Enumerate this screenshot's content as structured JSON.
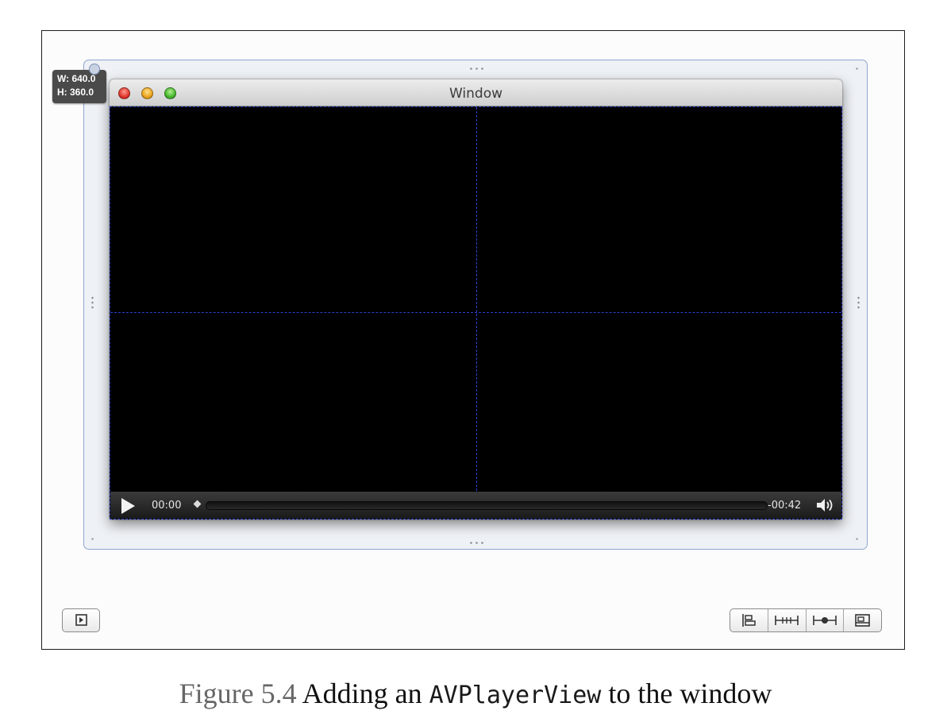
{
  "size_readout": {
    "width_label": "W: 640.0",
    "height_label": "H: 360.0"
  },
  "window": {
    "title": "Window"
  },
  "player": {
    "time_elapsed": "00:00",
    "time_remaining": "-00:42",
    "icons": {
      "play": "play-icon",
      "scrubber": "scrubber-knob-icon",
      "volume": "volume-icon"
    }
  },
  "canvas_buttons": {
    "left": "document-outline-icon",
    "right": [
      "align-icon",
      "pin-icon",
      "resolve-icon",
      "resizing-icon"
    ]
  },
  "caption": {
    "figure_number": "Figure 5.4",
    "text_before": "Adding an",
    "code": "AVPlayerView",
    "text_after": "to the window"
  },
  "colors": {
    "guide_lines": "#2a3fd0",
    "selection_frame": "#8fa6cf",
    "player_background": "#000000"
  }
}
